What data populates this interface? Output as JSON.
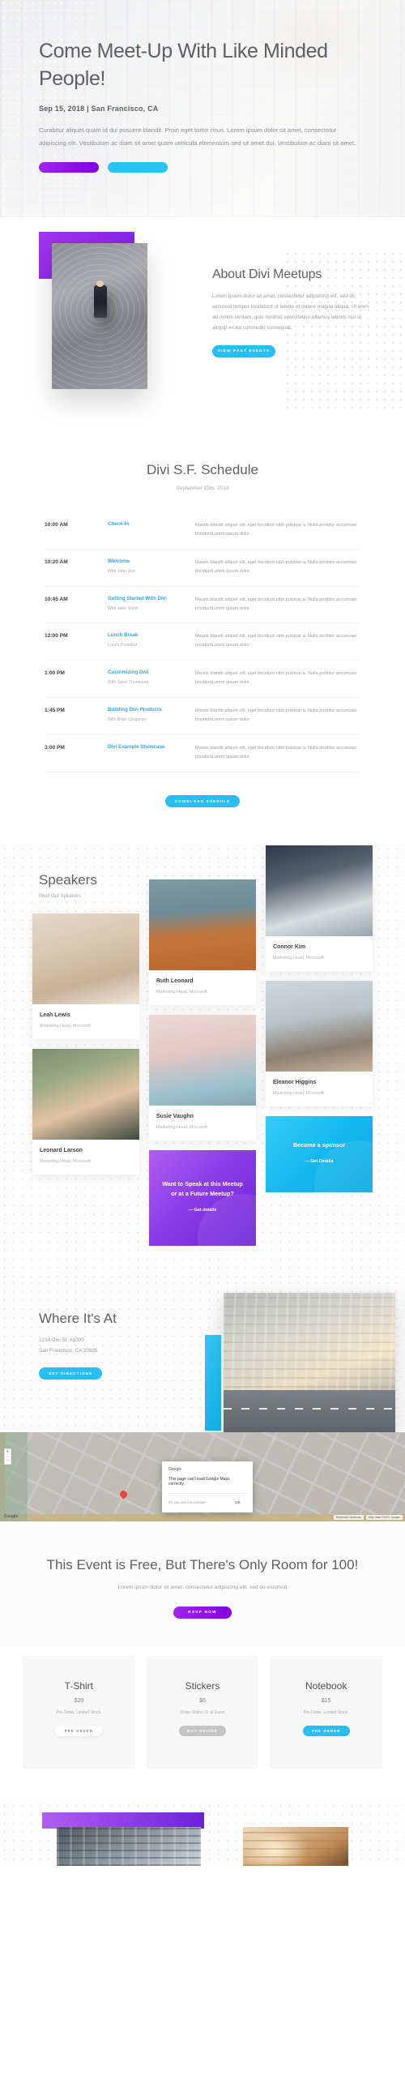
{
  "hero": {
    "title": "Come Meet-Up With Like Minded People!",
    "meta": "Sep 15, 2018 | San Francisco, CA",
    "body": "Curabitur aliquet quam id dui posuere blandit. Proin eget tortor risus. Lorem ipsum dolor sit amet, consectetur adipiscing elit. Vestibulum ac diam sit amet quam vehicula elementum sed sit amet dui. Vestibulum ac diam sit amet.",
    "button_primary": "",
    "button_secondary": ""
  },
  "about": {
    "title": "About Divi Meetups",
    "body": "Lorem ipsum dolor sit amet, consectetur adipiscing elit, sed do eiusmod tempor incididunt ut labore et dolore magna aliqua. Ut enim ad minim veniam, quis nostrud exercitation ullamco laboris nisi ut aliquip ex ea commodo consequat.",
    "button": "VIEW PAST EVENTS"
  },
  "schedule": {
    "title": "Divi S.F. Schedule",
    "subtitle": "September 15th, 2018",
    "description": "Mauris blandit aliquet elit, eget tincidunt nibh pulvinar a. Nulla porttitor accumsan tinciduntLorem ipsum dolor",
    "rows": [
      {
        "time": "10:00 AM",
        "title": "Check-In",
        "with": ""
      },
      {
        "time": "10:20 AM",
        "title": "Welcome",
        "with": "With John Doe"
      },
      {
        "time": "10:45 AM",
        "title": "Getting Started With Divi",
        "with": "With Jane Smith"
      },
      {
        "time": "12:00 PM",
        "title": "Lunch Break",
        "with": "Lunch Provided"
      },
      {
        "time": "1:00 PM",
        "title": "Customizing Divi",
        "with": "With Janet Thompson"
      },
      {
        "time": "1:45 PM",
        "title": "Building Divi Products",
        "with": "With Brian Chapman"
      },
      {
        "time": "3:00 PM",
        "title": "Divi Example Showcase",
        "with": ""
      }
    ],
    "button": "DOWNLOAD SHEDULE"
  },
  "speakers": {
    "title": "Speakers",
    "subtitle": "Meet Our Speakers",
    "people": [
      {
        "name": "Leah Lewis",
        "role": "Marketing Head, Microsoft"
      },
      {
        "name": "Leonard Larson",
        "role": "Marketing Head, Microsoft"
      },
      {
        "name": "Ruth Leonard",
        "role": "Marketing Head, Microsoft"
      },
      {
        "name": "Susie Vaughn",
        "role": "Marketing Head, Microsoft"
      },
      {
        "name": "Connor Kim",
        "role": "Marketing Head, Microsoft"
      },
      {
        "name": "Eleanor Higgins",
        "role": "Marketing Head, Microsoft"
      }
    ],
    "promo_speak": {
      "title": "Want to Speak at this Meetup or at a Future Meetup?",
      "link": "— Get details"
    },
    "promo_sponsor": {
      "title": "Become a sponsor",
      "link": "— Get Details"
    }
  },
  "location": {
    "title": "Where It's At",
    "address_line1": "1234 Divi St. #1000",
    "address_line2": "San Francisco, CA 20935",
    "button": "GET DIRECTIONS"
  },
  "map": {
    "dialog_title": "Google",
    "dialog_message": "This page can't load Google Maps correctly.",
    "dialog_link": "Do you own this website?",
    "dialog_ok": "OK",
    "zoom_in": "+",
    "zoom_out": "−",
    "logo": "Google",
    "attrib_shortcuts": "Keyboard shortcuts",
    "attrib_data": "Map data ©2021 Google"
  },
  "rsvp": {
    "title": "This Event is Free, But There's Only Room for 100!",
    "subtitle": "Lorem ipsum dolor sit amet, consectetur adipiscing elit, sed do eiusmod",
    "button": "RSVP NOW"
  },
  "products": [
    {
      "name": "T-Shirt",
      "price": "$20",
      "note": "Pre-Order, Limited Stock.",
      "button": "PRE ORDER",
      "button_style": "white"
    },
    {
      "name": "Stickers",
      "price": "$6",
      "note": "Order Online Or at Event",
      "button": "BUY ONLINE",
      "button_style": "grey"
    },
    {
      "name": "Notebook",
      "price": "$15",
      "note": "Pre-Order, Limited Stock.",
      "button": "PRE ORDER",
      "button_style": "cyan"
    }
  ],
  "colors": {
    "purple": "#8b3ce8",
    "cyan": "#29bdf2",
    "link_blue": "#2ea3f2",
    "heading": "#5e5f63",
    "body_text": "#9a9ca1"
  }
}
